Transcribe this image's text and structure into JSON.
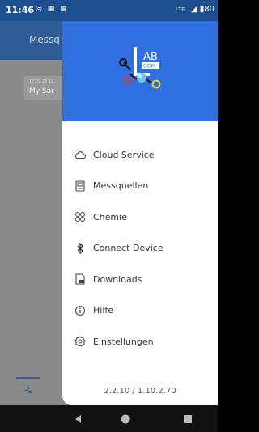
{
  "status": {
    "time": "11:46",
    "left_icons": "◎ ▦ ▦",
    "net": "LTE",
    "signal": "◢",
    "battery": "▮80"
  },
  "app": {
    "title": "Messq"
  },
  "background_card": {
    "date": "17.03.23 11",
    "name": "My Sar"
  },
  "drawer": {
    "logo_text_1": "AB",
    "logo_text_2": "COM",
    "menu": [
      {
        "label": "Cloud Service",
        "icon": "cloud-icon"
      },
      {
        "label": "Messquellen",
        "icon": "device-icon"
      },
      {
        "label": "Chemie",
        "icon": "chemistry-icon"
      },
      {
        "label": "Connect Device",
        "icon": "bluetooth-icon"
      },
      {
        "label": "Downloads",
        "icon": "pdf-icon"
      },
      {
        "label": "Hilfe",
        "icon": "info-icon"
      },
      {
        "label": "Einstellungen",
        "icon": "gear-icon"
      }
    ],
    "version": "2.2.10 / 1.10.2.70"
  },
  "colors": {
    "header": "#2f6fe0",
    "appbar": "#2f5c97",
    "scrim": "#8a8a8a"
  }
}
